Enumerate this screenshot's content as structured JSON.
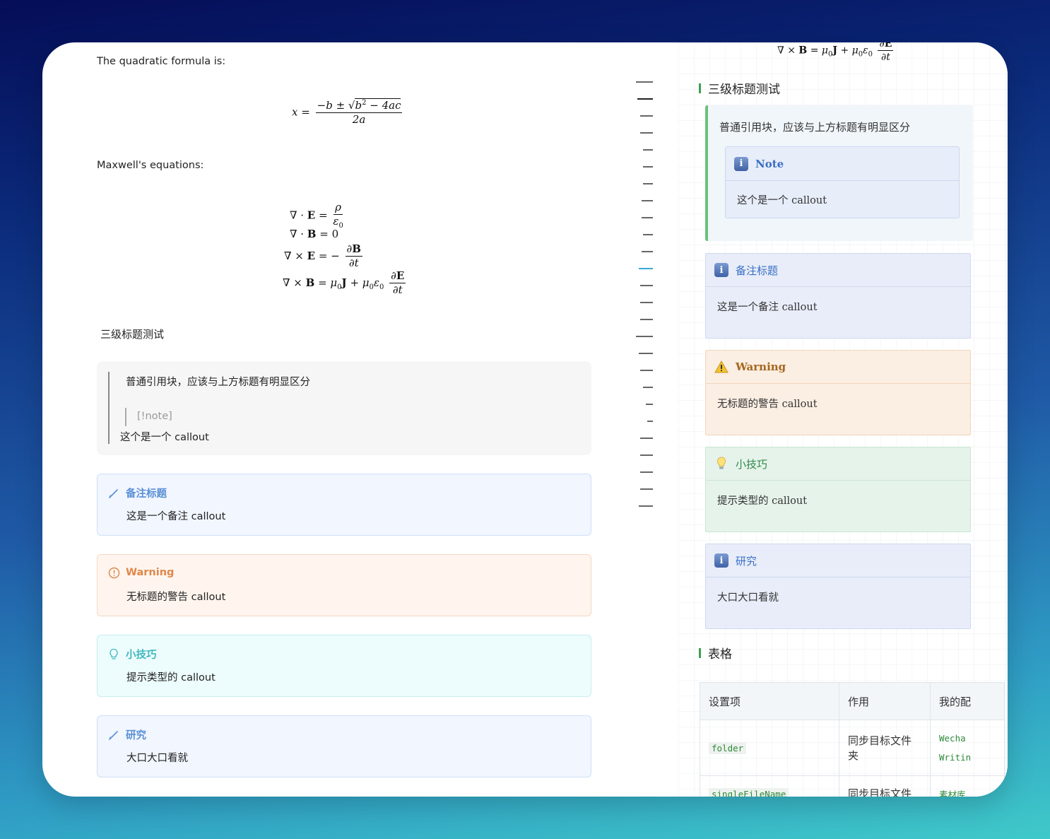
{
  "left": {
    "intro_quadratic": "The quadratic formula is:",
    "intro_maxwell": "Maxwell's equations:",
    "heading_h3": "三级标题测试",
    "quote": {
      "text": "普通引用块，应该与上方标题有明显区分",
      "nested_marker": "[!note]",
      "nested_text": "这个是一个 callout"
    },
    "callouts": [
      {
        "title": "备注标题",
        "body": "这是一个备注 callout",
        "icon": "pencil-icon",
        "color": "#5b8fd6"
      },
      {
        "title": "Warning",
        "body": "无标题的警告 callout",
        "icon": "alert-circle-icon",
        "color": "#e0874a"
      },
      {
        "title": "小技巧",
        "body": "提示类型的 callout",
        "icon": "lightbulb-icon",
        "color": "#3fb8c0"
      },
      {
        "title": "研究",
        "body": "大口大口看就",
        "icon": "pencil-icon",
        "color": "#5b8fd6"
      }
    ]
  },
  "toc": {
    "active_index": 11,
    "active_color": "#3aa7d6"
  },
  "right": {
    "heading_h3": "三级标题测试",
    "quote": {
      "text": "普通引用块，应该与上方标题有明显区分",
      "note_title": "Note",
      "note_body": "这个是一个 callout"
    },
    "callouts": [
      {
        "title": "备注标题",
        "body": "这是一个备注 callout",
        "icon": "info-icon"
      },
      {
        "title": "Warning",
        "body": "无标题的警告 callout",
        "icon": "warning-triangle-icon"
      },
      {
        "title": "小技巧",
        "body": "提示类型的 callout",
        "icon": "lightbulb-icon"
      },
      {
        "title": "研究",
        "body": "大口大口看就",
        "icon": "info-icon"
      }
    ],
    "heading_table": "表格",
    "table": {
      "headers": [
        "设置项",
        "作用",
        "我的配"
      ],
      "rows": [
        {
          "key": "folder",
          "desc": "同步目标文件夹",
          "value1": "Wecha",
          "value2": "Writin"
        },
        {
          "key": "singleFileName",
          "desc": "同步目标文件名",
          "value1": "素材库",
          "value2": ""
        }
      ]
    }
  }
}
